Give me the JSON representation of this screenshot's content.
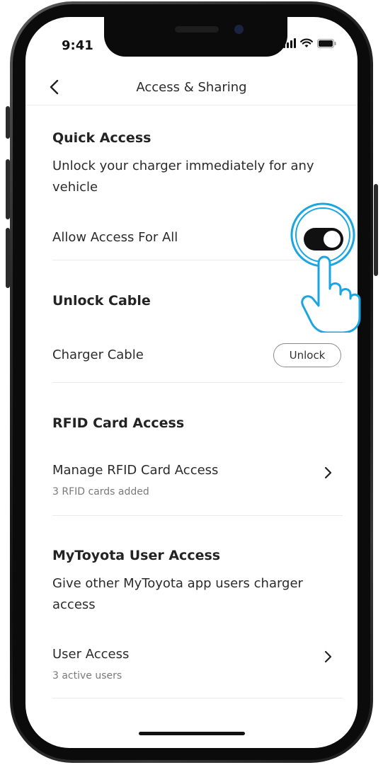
{
  "status_bar": {
    "time": "9:41"
  },
  "header": {
    "title": "Access & Sharing"
  },
  "quick_access": {
    "title": "Quick Access",
    "description": "Unlock your charger immediately for any vehicle",
    "allow_label": "Allow Access For All",
    "allow_enabled": true
  },
  "unlock_cable": {
    "title": "Unlock Cable",
    "cable_label": "Charger Cable",
    "unlock_button": "Unlock"
  },
  "rfid": {
    "title": "RFID Card Access",
    "manage_label": "Manage RFID Card Access",
    "manage_sub": "3 RFID cards added"
  },
  "mytoyota": {
    "title": "MyToyota User Access",
    "description": "Give other MyToyota app users charger access",
    "user_access_label": "User Access",
    "user_access_sub": "3 active users"
  },
  "colors": {
    "accent_highlight": "#1aa6e0",
    "toggle_on": "#111111"
  }
}
